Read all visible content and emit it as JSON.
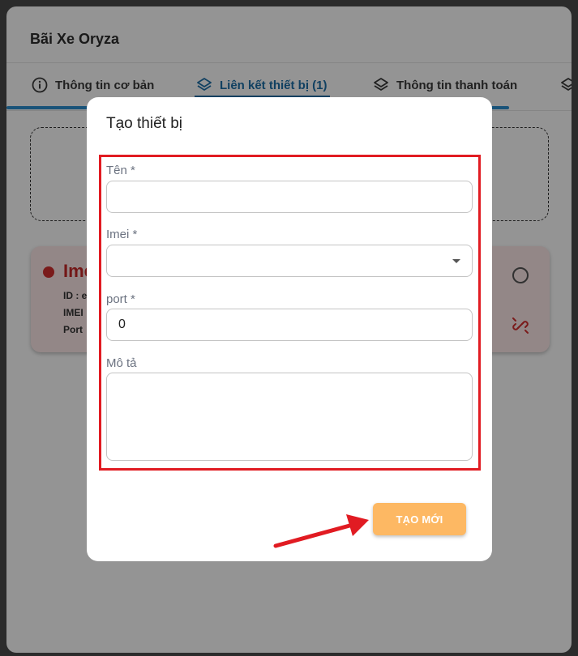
{
  "panel": {
    "title": "Bãi Xe Oryza",
    "tabs": [
      {
        "label": "Thông tin cơ bản",
        "icon": "info-icon"
      },
      {
        "label": "Liên kết thiết bị (1)",
        "icon": "layers-icon",
        "active": true
      },
      {
        "label": "Thông tin thanh toán",
        "icon": "layers-icon"
      }
    ],
    "device_card": {
      "name": "Ime",
      "id_label": "ID : e",
      "imei_label": "IMEI",
      "port_label": "Port"
    }
  },
  "modal": {
    "title": "Tạo thiết bị",
    "fields": {
      "name": {
        "label": "Tên *",
        "value": ""
      },
      "imei": {
        "label": "Imei *",
        "value": ""
      },
      "port": {
        "label": "port *",
        "value": "0"
      },
      "description": {
        "label": "Mô tả",
        "value": ""
      }
    },
    "create_label": "TẠO MỚI"
  },
  "colors": {
    "accent": "#1d6fa8",
    "button": "#fdb863",
    "highlight": "#e11b22",
    "status_error": "#d32f2f"
  }
}
